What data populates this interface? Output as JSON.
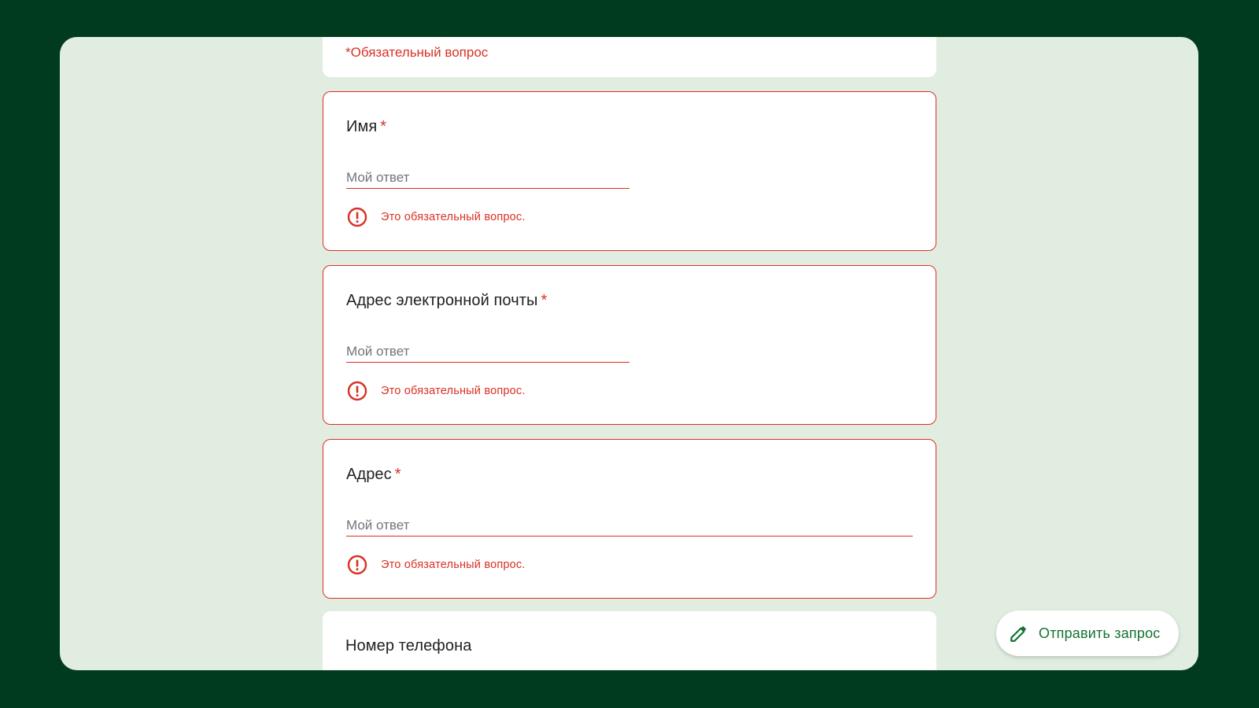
{
  "form": {
    "required_note": "*Обязательный вопрос",
    "questions": [
      {
        "title": "Имя",
        "required_mark": "*",
        "placeholder": "Мой ответ",
        "error": "Это обязательный вопрос."
      },
      {
        "title": "Адрес электронной почты",
        "required_mark": "*",
        "placeholder": "Мой ответ",
        "error": "Это обязательный вопрос."
      },
      {
        "title": "Адрес",
        "required_mark": "*",
        "placeholder": "Мой ответ",
        "error": "Это обязательный вопрос."
      },
      {
        "title": "Номер телефона"
      }
    ]
  },
  "fab": {
    "label": "Отправить запрос",
    "icon": "pencil-icon"
  },
  "colors": {
    "page_background": "#003b1e",
    "form_background": "#e1ede0",
    "error": "#d93025",
    "accent": "#137333"
  }
}
